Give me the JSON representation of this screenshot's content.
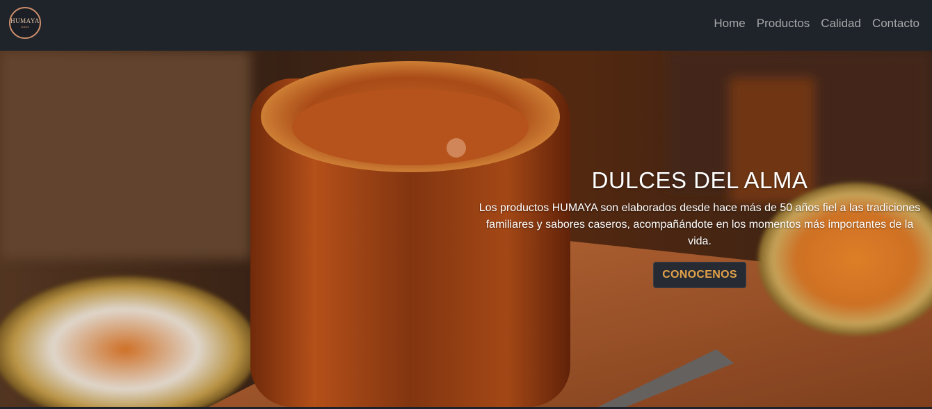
{
  "brand": {
    "logo_text": "HUMAYA",
    "logo_sub": "dulces"
  },
  "nav": {
    "items": [
      {
        "label": "Home"
      },
      {
        "label": "Productos"
      },
      {
        "label": "Calidad"
      },
      {
        "label": "Contacto"
      }
    ]
  },
  "hero": {
    "title": "DULCES DEL ALMA",
    "text": "Los productos HUMAYA son elaborados desde hace más de 50 años fiel a las tradiciones familiares y sabores caseros, acompañándote en los momentos más importantes de la vida.",
    "button_label": "CONOCENOS",
    "image_icon": "caramel-jar-photo"
  },
  "colors": {
    "navbar": "#1f232a",
    "nav_link": "#a7a9ab",
    "button_bg": "#262b33",
    "button_text": "#e4a24a"
  }
}
